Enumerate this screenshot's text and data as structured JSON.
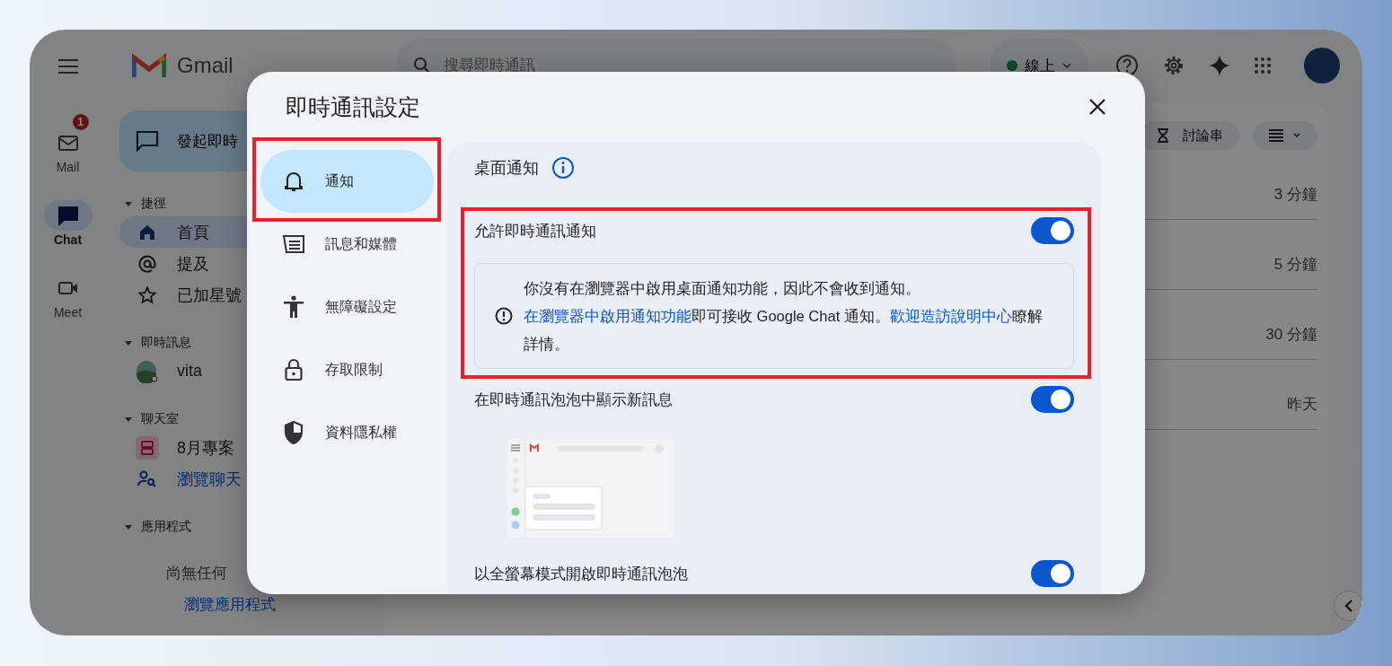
{
  "topbar": {
    "brand": "Gmail",
    "search": {
      "placeholder": "搜尋即時通訊"
    },
    "status": {
      "label": "線上"
    }
  },
  "rail": [
    {
      "kind": "mail",
      "label": "Mail",
      "badge": "1",
      "selected": false
    },
    {
      "kind": "chat",
      "label": "Chat",
      "selected": true
    },
    {
      "kind": "meet",
      "label": "Meet",
      "selected": false
    }
  ],
  "nav": {
    "compose": "發起即時",
    "sections": [
      {
        "title": "捷徑",
        "items": [
          {
            "kind": "home",
            "label": "首頁",
            "selected": true
          },
          {
            "kind": "mention",
            "label": "提及",
            "selected": false
          },
          {
            "kind": "star",
            "label": "已加星號",
            "selected": false
          }
        ]
      },
      {
        "title": "即時訊息",
        "items": [
          {
            "kind": "person",
            "label": "vita",
            "selected": false
          }
        ]
      },
      {
        "title": "聊天室",
        "items": [
          {
            "kind": "space",
            "label": "8月專案",
            "selected": false
          },
          {
            "kind": "browse",
            "label": "瀏覽聊天",
            "selected": false,
            "link": true
          }
        ]
      },
      {
        "title": "應用程式",
        "empty_text": "尚無任何",
        "empty_link": "瀏覽應用程式"
      }
    ]
  },
  "list": {
    "threads_button": "討論串",
    "times": [
      "3 分鐘",
      "5 分鐘",
      "30 分鐘",
      "昨天"
    ]
  },
  "dialog": {
    "title": "即時通訊設定",
    "nav": [
      {
        "kind": "bell",
        "label": "通知",
        "selected": true,
        "highlighted": true
      },
      {
        "kind": "message",
        "label": "訊息和媒體",
        "selected": false,
        "highlighted": false
      },
      {
        "kind": "accessibility",
        "label": "無障礙設定",
        "selected": false,
        "highlighted": false
      },
      {
        "kind": "lock",
        "label": "存取限制",
        "selected": false,
        "highlighted": false
      },
      {
        "kind": "shield",
        "label": "資料隱私權",
        "selected": false,
        "highlighted": false
      }
    ],
    "section": {
      "title": "桌面通知",
      "groups": [
        {
          "highlighted": true,
          "rows": [
            {
              "kind": "toggle",
              "label": "允許即時通訊通知",
              "on": true
            },
            {
              "kind": "notice",
              "lines": [
                [
                  {
                    "text": "你沒有在瀏覽器中啟用桌面通知功能，因此不會收到通知。",
                    "link": false
                  }
                ],
                [
                  {
                    "text": "在瀏覽器中啟用通知功能",
                    "link": true
                  },
                  {
                    "text": "即可接收 Google Chat 通知。",
                    "link": false
                  },
                  {
                    "text": "歡迎造訪說明中心",
                    "link": true
                  },
                  {
                    "text": "瞭解詳情。",
                    "link": false
                  }
                ]
              ]
            }
          ]
        },
        {
          "highlighted": false,
          "rows": [
            {
              "kind": "toggle",
              "label": "在即時通訊泡泡中顯示新訊息",
              "on": true
            },
            {
              "kind": "illustration"
            },
            {
              "kind": "toggle",
              "label": "以全螢幕模式開啟即時通訊泡泡",
              "on": true
            }
          ]
        }
      ]
    }
  }
}
